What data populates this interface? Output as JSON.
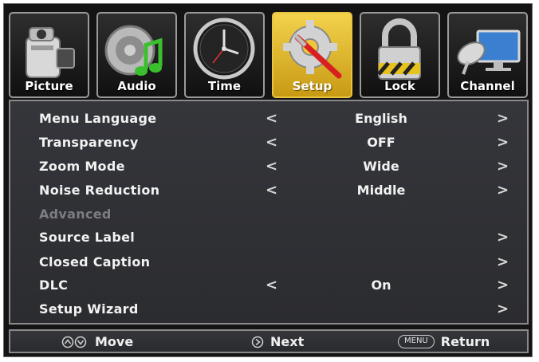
{
  "tabs": [
    {
      "label": "Picture",
      "icon": "camcorder-icon"
    },
    {
      "label": "Audio",
      "icon": "speaker-music-icon"
    },
    {
      "label": "Time",
      "icon": "clock-icon"
    },
    {
      "label": "Setup",
      "icon": "gear-tools-icon",
      "selected": true
    },
    {
      "label": "Lock",
      "icon": "padlock-icon"
    },
    {
      "label": "Channel",
      "icon": "satellite-monitor-icon"
    }
  ],
  "menu": {
    "items": [
      {
        "label": "Menu Language",
        "value": "English",
        "left_arrow": "<",
        "right_arrow": ">"
      },
      {
        "label": "Transparency",
        "value": "OFF",
        "left_arrow": "<",
        "right_arrow": ">"
      },
      {
        "label": "Zoom Mode",
        "value": "Wide",
        "left_arrow": "<",
        "right_arrow": ">"
      },
      {
        "label": "Noise Reduction",
        "value": "Middle",
        "left_arrow": "<",
        "right_arrow": ">"
      },
      {
        "label": "Advanced",
        "disabled": true
      },
      {
        "label": "Source Label",
        "right_arrow": ">"
      },
      {
        "label": "Closed Caption",
        "right_arrow": ">"
      },
      {
        "label": "DLC",
        "value": "On",
        "left_arrow": "<",
        "right_arrow": ">"
      },
      {
        "label": "Setup Wizard",
        "right_arrow": ">"
      }
    ]
  },
  "footer": {
    "move_label": "Move",
    "next_label": "Next",
    "menu_key_label": "MENU",
    "return_label": "Return"
  },
  "colors": {
    "selected_tab": "#e8c440",
    "panel_bg": "#323338",
    "disabled_text": "#7c7d82"
  }
}
